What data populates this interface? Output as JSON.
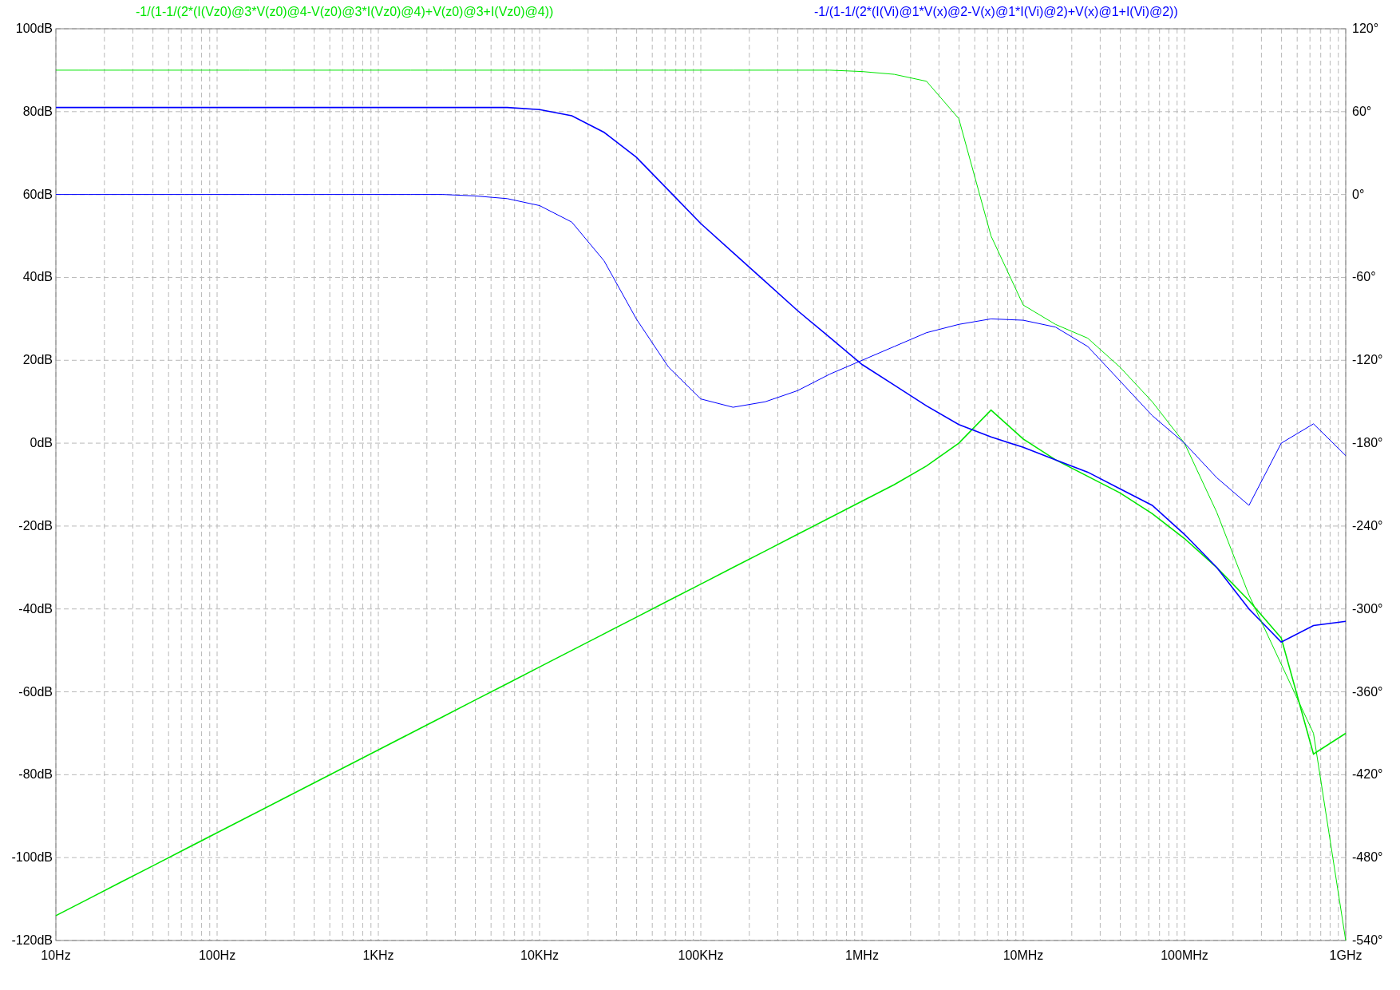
{
  "plot": {
    "chart_data": {
      "type": "line",
      "grid": true,
      "categories": [
        "10Hz",
        null,
        null,
        null,
        null,
        "100Hz",
        null,
        null,
        null,
        null,
        "1KHz",
        null,
        null,
        null,
        null,
        "10KHz",
        null,
        null,
        null,
        null,
        "100KHz",
        null,
        null,
        null,
        null,
        "1MHz",
        null,
        null,
        null,
        null,
        "10MHz",
        null,
        null,
        null,
        null,
        "100MHz",
        null,
        null,
        null,
        null,
        "1GHz"
      ],
      "ylim": [
        -120,
        100
      ],
      "yticks": [
        {
          "value": 100,
          "label": "100dB"
        },
        {
          "value": 80,
          "label": "80dB"
        },
        {
          "value": 60,
          "label": "60dB"
        },
        {
          "value": 40,
          "label": "40dB"
        },
        {
          "value": 20,
          "label": "20dB"
        },
        {
          "value": 0,
          "label": "0dB"
        },
        {
          "value": -20,
          "label": "-20dB"
        },
        {
          "value": -40,
          "label": "-40dB"
        },
        {
          "value": -60,
          "label": "-60dB"
        },
        {
          "value": -80,
          "label": "-80dB"
        },
        {
          "value": -100,
          "label": "-100dB"
        },
        {
          "value": -120,
          "label": "-120dB"
        }
      ],
      "y2lim": [
        -540,
        120
      ],
      "y2ticks": [
        {
          "value": 120,
          "label": "120°"
        },
        {
          "value": 60,
          "label": "60°"
        },
        {
          "value": 0,
          "label": "0°"
        },
        {
          "value": -60,
          "label": "-60°"
        },
        {
          "value": -120,
          "label": "-120°"
        },
        {
          "value": -180,
          "label": "-180°"
        },
        {
          "value": -240,
          "label": "-240°"
        },
        {
          "value": -300,
          "label": "-300°"
        },
        {
          "value": -360,
          "label": "-360°"
        },
        {
          "value": -420,
          "label": "-420°"
        },
        {
          "value": -480,
          "label": "-480°"
        },
        {
          "value": -540,
          "label": "-540°"
        }
      ],
      "series": [
        {
          "name": "-1/(1-1/(2*(I(Vz0)@3*V(z0)@4-V(z0)@3*I(Vz0)@4)+V(z0)@3+I(Vz0)@4))",
          "color": "#00e600",
          "values": [
            -114,
            -110,
            -106,
            -102,
            -98,
            -94,
            -90,
            -86,
            -82,
            -78,
            -74,
            -70,
            -66,
            -62,
            -58,
            -54,
            -50,
            -46,
            -42,
            -38,
            -34,
            -30,
            -26,
            -22,
            -18,
            -14,
            -10,
            -5.5,
            0,
            8,
            1,
            -4,
            -8,
            -12,
            -17,
            -23,
            -30,
            -38,
            -47,
            -75,
            -70
          ]
        },
        {
          "name": "-1/(1-1/(2*(I(Vi)@1*V(x)@2-V(x)@1*I(Vi)@2)+V(x)@1+I(Vi)@2))",
          "color": "#0000ff",
          "values": [
            81,
            81,
            81,
            81,
            81,
            81,
            81,
            81,
            81,
            81,
            81,
            81,
            81,
            81,
            81,
            80.5,
            79,
            75,
            69,
            61,
            53,
            46,
            39,
            32,
            25.5,
            19,
            14,
            9,
            4.5,
            1.5,
            -1,
            -4,
            -7,
            -11,
            -15,
            -22,
            -30,
            -40,
            -48,
            -44,
            -43
          ]
        },
        {
          "axis": "y2",
          "color": "#00e600",
          "values": [
            90,
            90,
            90,
            90,
            90,
            90,
            90,
            90,
            90,
            90,
            90,
            90,
            90,
            90,
            90,
            90,
            90,
            90,
            90,
            90,
            90,
            90,
            90,
            90,
            90,
            89,
            87,
            82,
            55,
            -30,
            -80,
            -94,
            -104,
            -125,
            -150,
            -180,
            -230,
            -290,
            -340,
            -390,
            -540
          ]
        },
        {
          "axis": "y2",
          "color": "#0000ff",
          "values": [
            0,
            0,
            0,
            0,
            0,
            0,
            0,
            0,
            0,
            0,
            0,
            0,
            0,
            -1,
            -3,
            -8,
            -20,
            -48,
            -90,
            -125,
            -148,
            -154,
            -150,
            -142,
            -130,
            -120,
            -110,
            -100,
            -94,
            -90,
            -91,
            -96,
            -110,
            -135,
            -160,
            -180,
            -205,
            -225,
            -180,
            -166,
            -189
          ]
        }
      ]
    }
  }
}
